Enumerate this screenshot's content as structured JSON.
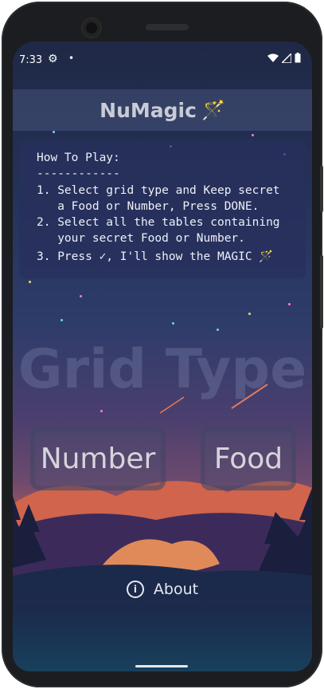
{
  "status": {
    "time": "7:33",
    "settings_icon": "gear-icon",
    "dot": "•",
    "wifi_icon": "wifi-icon",
    "signal_icon": "signal-icon",
    "battery_icon": "battery-icon"
  },
  "appbar": {
    "title": "NuMagic",
    "icon": "magic-wand-icon"
  },
  "howto": {
    "title": "How To Play:",
    "divider": "------------",
    "lines": [
      "1. Select grid type and Keep secret",
      "   a Food or Number, Press DONE.",
      "2. Select all the tables containing",
      "   your secret Food or Number.",
      "3. Press ✓, I'll show the MAGIC 🪄"
    ]
  },
  "grid_type": {
    "label": "Grid Type"
  },
  "buttons": {
    "number": "Number",
    "food": "Food"
  },
  "about": {
    "label": "About",
    "icon": "info-icon"
  }
}
